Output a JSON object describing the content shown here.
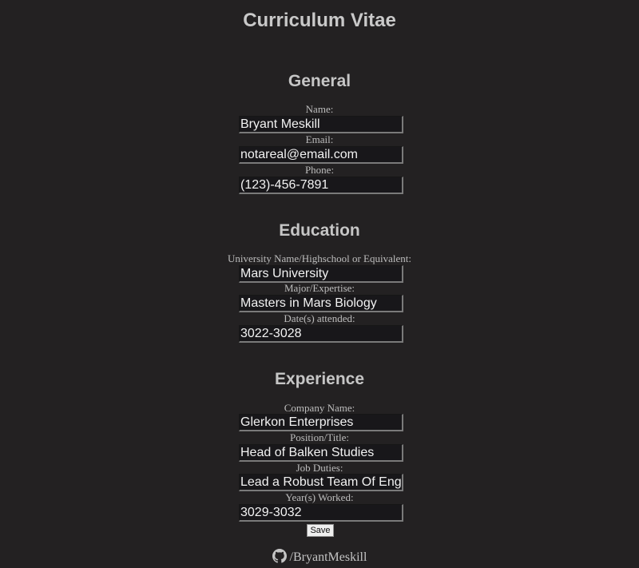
{
  "title": "Curriculum Vitae",
  "sections": {
    "general": {
      "title": "General",
      "fields": [
        {
          "label": "Name:",
          "value": "Bryant Meskill"
        },
        {
          "label": "Email:",
          "value": "notareal@email.com"
        },
        {
          "label": "Phone:",
          "value": "(123)-456-7891"
        }
      ]
    },
    "education": {
      "title": "Education",
      "fields": [
        {
          "label": "University Name/Highschool or Equivalent:",
          "value": "Mars University"
        },
        {
          "label": "Major/Expertise:",
          "value": "Masters in Mars Biology"
        },
        {
          "label": "Date(s) attended:",
          "value": "3022-3028"
        }
      ]
    },
    "experience": {
      "title": "Experience",
      "fields": [
        {
          "label": "Company Name:",
          "value": "Glerkon Enterprises"
        },
        {
          "label": "Position/Title:",
          "value": "Head of Balken Studies"
        },
        {
          "label": "Job Duties:",
          "value": "Lead a Robust Team Of Eng"
        },
        {
          "label": "Year(s) Worked:",
          "value": "3029-3032"
        }
      ]
    }
  },
  "save_label": "Save",
  "footer": {
    "icon": "github-icon",
    "link_text": "/BryantMeskill"
  }
}
